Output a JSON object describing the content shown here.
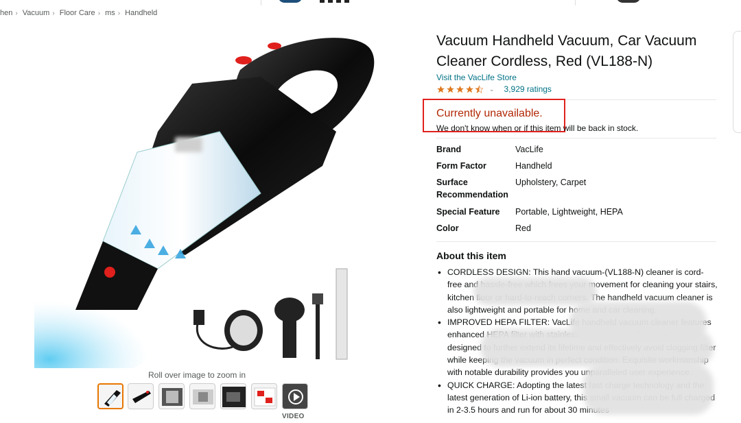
{
  "breadcrumb": {
    "items": [
      "hen",
      "Vacuum",
      "Floor Care",
      "ms",
      "Handheld"
    ]
  },
  "gallery": {
    "zoom_hint": "Roll over image to zoom in",
    "video_label": "VIDEO",
    "thumbnail_count": 7
  },
  "product": {
    "title": "Vacuum Handheld Vacuum, Car Vacuum Cleaner Cordless, Red (VL188-N)",
    "store_link": "Visit the VacLife Store",
    "rating_stars": 4.5,
    "ratings_count": "3,929 ratings",
    "availability": "Currently unavailable.",
    "availability_note": "We don't know when or if this item will be back in stock."
  },
  "specs": [
    {
      "key": "Brand",
      "value": "VacLife"
    },
    {
      "key": "Form Factor",
      "value": "Handheld"
    },
    {
      "key": "Surface Recommendation",
      "value": "Upholstery, Carpet"
    },
    {
      "key": "Special Feature",
      "value": "Portable, Lightweight, HEPA"
    },
    {
      "key": "Color",
      "value": "Red"
    }
  ],
  "about": {
    "heading": "About this item",
    "bullets": [
      "CORDLESS DESIGN: This hand vacuum-(VL188-N) cleaner is cord-free and hassle-free which frees your movement for cleaning your stairs, kitchen floor or hard-to-reach corners. The handheld vacuum cleaner is also lightweight and portable for home and car cleaning.",
      "IMPROVED HEPA FILTER: VacLife handheld vacuum cleaner features enhanced HEPA filter with stainless steel medium filter which is designed to further extend its lifetime and effectively avoid clogging filter while keeping the vacuum in perfect condition. Exquisite workmanship with notable durability provides you unparalleled user experience.",
      "QUICK CHARGE: Adopting the latest fast charge technology and the latest generation of Li-ion battery, this small vacuum can be full charged in 2-3.5 hours and run for about 30 minutes"
    ]
  },
  "colors": {
    "link": "#007185",
    "price_red": "#b12704",
    "star": "#de7921",
    "highlight_box": "#e0201c",
    "product_red": "#e0201c"
  }
}
